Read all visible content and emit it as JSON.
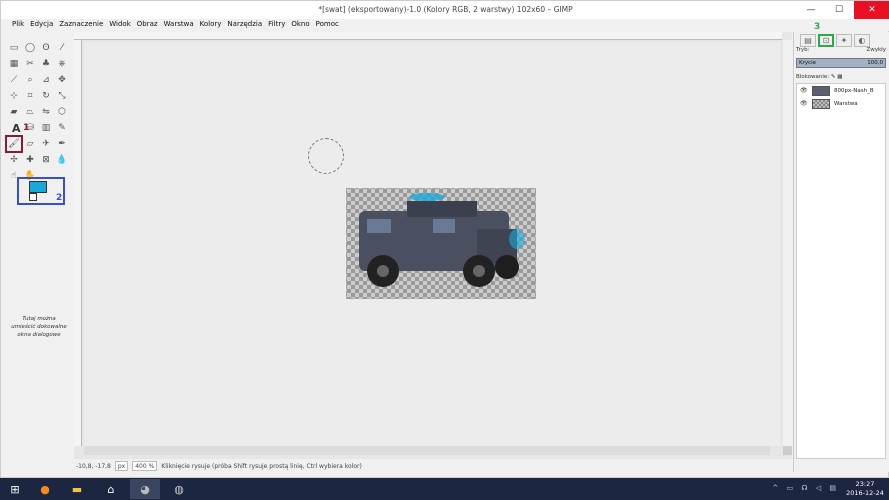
{
  "window": {
    "title": "*[swat] (eksportowany)-1.0 (Kolory RGB, 2 warstwy) 102x60 – GIMP",
    "min_glyph": "—",
    "max_glyph": "☐",
    "close_glyph": "✕"
  },
  "menu": [
    "Plik",
    "Edycja",
    "Zaznaczenie",
    "Widok",
    "Obraz",
    "Warstwa",
    "Kolory",
    "Narzędzia",
    "Filtry",
    "Okno",
    "Pomoc"
  ],
  "toolbox": {
    "tools": [
      {
        "icon": "rect-select-icon",
        "glyph": "▭"
      },
      {
        "icon": "ellipse-select-icon",
        "glyph": "◯"
      },
      {
        "icon": "free-select-icon",
        "glyph": "ʘ"
      },
      {
        "icon": "fuzzy-select-icon",
        "glyph": "⁄"
      },
      {
        "icon": "select-by-color-icon",
        "glyph": "▦"
      },
      {
        "icon": "scissors-select-icon",
        "glyph": "✂"
      },
      {
        "icon": "foreground-select-icon",
        "glyph": "♣"
      },
      {
        "icon": "paths-icon",
        "glyph": "⎈"
      },
      {
        "icon": "color-picker-icon",
        "glyph": "⟋"
      },
      {
        "icon": "zoom-icon",
        "glyph": "⌕"
      },
      {
        "icon": "measure-icon",
        "glyph": "⊿"
      },
      {
        "icon": "move-icon",
        "glyph": "✥"
      },
      {
        "icon": "align-icon",
        "glyph": "⊹"
      },
      {
        "icon": "crop-icon",
        "glyph": "⌗"
      },
      {
        "icon": "rotate-icon",
        "glyph": "↻"
      },
      {
        "icon": "scale-icon",
        "glyph": "⤡"
      },
      {
        "icon": "shear-icon",
        "glyph": "▰"
      },
      {
        "icon": "perspective-icon",
        "glyph": "⏢"
      },
      {
        "icon": "flip-icon",
        "glyph": "⇋"
      },
      {
        "icon": "cage-icon",
        "glyph": "⬡"
      },
      {
        "icon": "text-icon",
        "glyph": ""
      },
      {
        "icon": "bucket-fill-icon",
        "glyph": "⛁"
      },
      {
        "icon": "blend-icon",
        "glyph": "▥"
      },
      {
        "icon": "pencil-icon",
        "glyph": "✎"
      },
      {
        "icon": "paintbrush-icon",
        "glyph": "🖌"
      },
      {
        "icon": "eraser-icon",
        "glyph": "▱"
      },
      {
        "icon": "airbrush-icon",
        "glyph": "✈"
      },
      {
        "icon": "ink-icon",
        "glyph": "✒"
      },
      {
        "icon": "clone-icon",
        "glyph": "✢"
      },
      {
        "icon": "heal-icon",
        "glyph": "✚"
      },
      {
        "icon": "perspective-clone-icon",
        "glyph": "⊠"
      },
      {
        "icon": "blur-icon",
        "glyph": "💧"
      },
      {
        "icon": "smudge-icon",
        "glyph": "☝"
      },
      {
        "icon": "dodge-burn-icon",
        "glyph": "✋"
      }
    ],
    "label_a": "A",
    "label_1": "1",
    "label_2": "2",
    "dock_hint": "Tutaj można umieścić dokowalne okna dialogowe"
  },
  "statusbar": {
    "coords": "-10,8, -17,8",
    "unit": "px",
    "zoom": "400 %",
    "message": "Kliknięcie rysuje (próba Shift rysuje prostą linię, Ctrl wybiera kolor)"
  },
  "dock": {
    "label_3": "3",
    "mode_label": "Tryb:",
    "mode_value": "Zwykły",
    "opacity_label": "Krycie",
    "opacity_value": "100,0",
    "lock_label": "Blokowanie:",
    "layers": [
      {
        "name": "800px-Nash_B",
        "thumb": "image"
      },
      {
        "name": "Warstwa",
        "thumb": "checker"
      }
    ]
  },
  "taskbar": {
    "time": "23:27",
    "date": "2016-12-24",
    "tray": "^ ▭ ☊ ◁ ▤"
  },
  "colors": {
    "fg": "#1aa8d8",
    "bg": "#ffffff",
    "annotation_red": "#8b1a2e",
    "annotation_blue": "#3a4fc0",
    "annotation_green": "#2aa84a"
  }
}
